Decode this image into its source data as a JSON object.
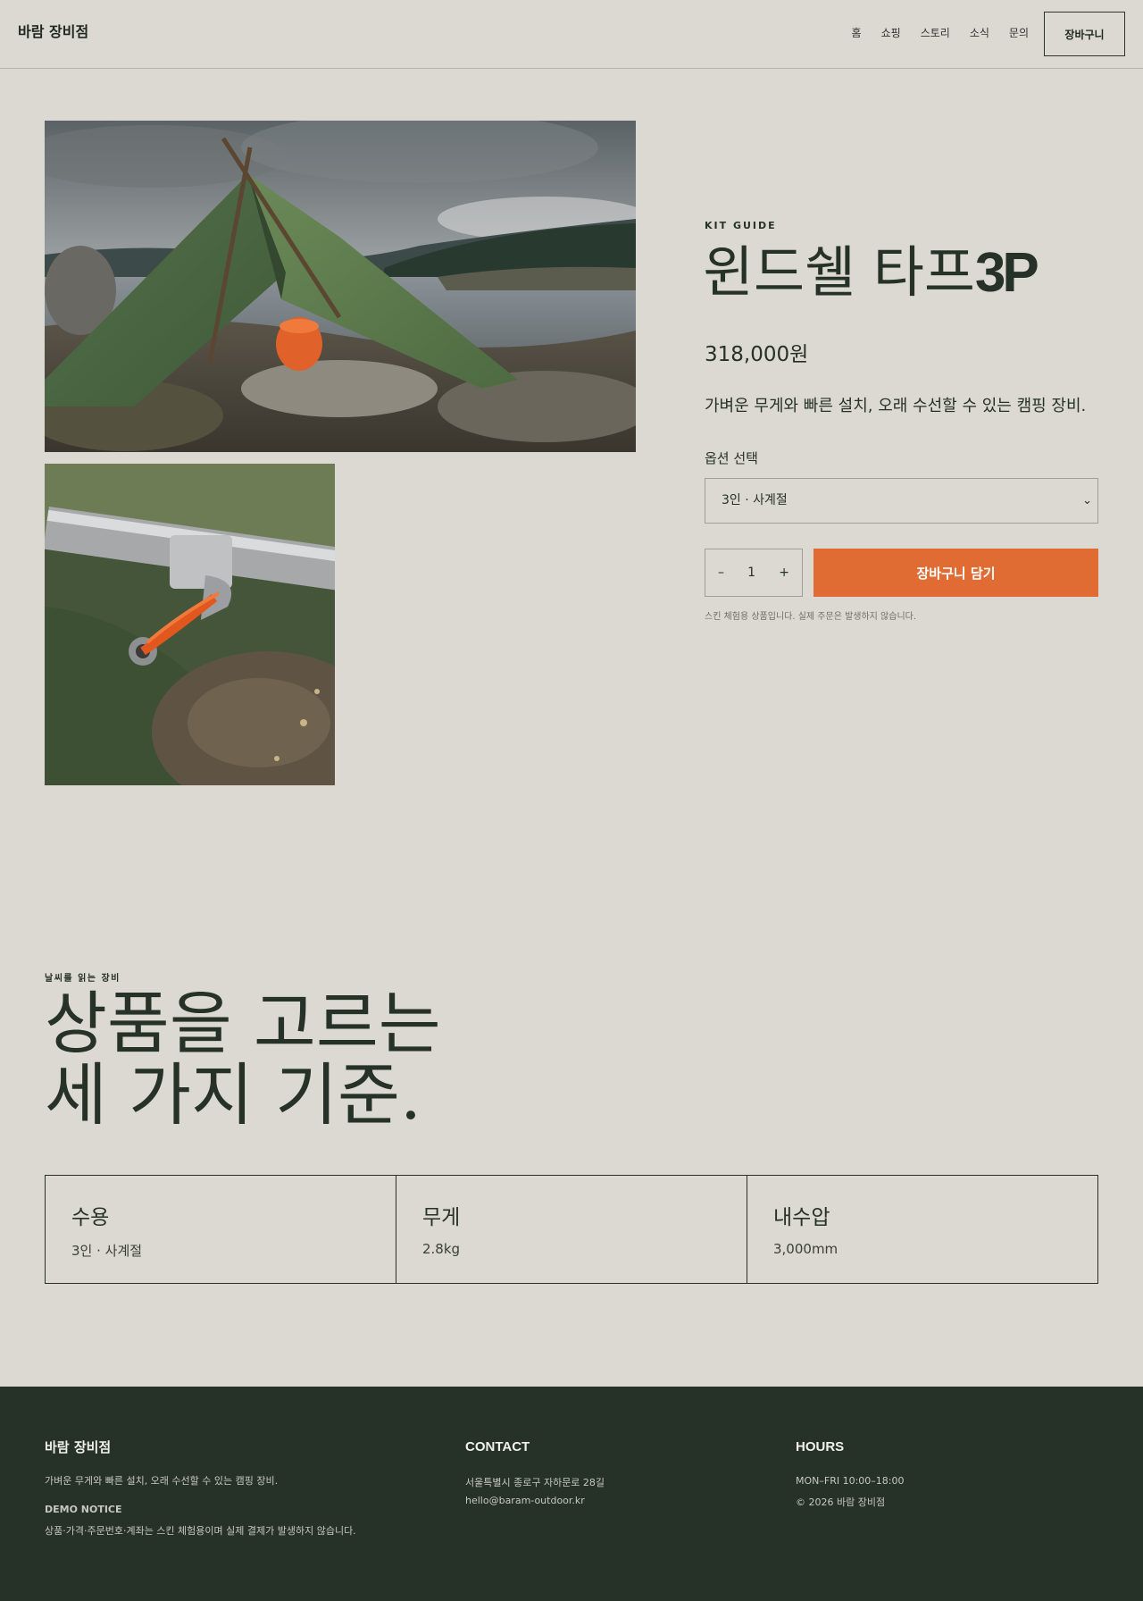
{
  "header": {
    "brand": "바람 장비점",
    "nav": [
      "홈",
      "쇼핑",
      "스토리",
      "소식",
      "문의"
    ],
    "cart_label": "장바구니"
  },
  "product": {
    "kicker": "KIT GUIDE",
    "title_ko": "윈드쉘 타프",
    "title_latin": "3P",
    "price": "318,000원",
    "description": "가벼운 무게와 빠른 설치, 오래 수선할 수 있는 캠핑 장비.",
    "option_label": "옵션 선택",
    "option_selected": "3인 · 사계절",
    "qty_minus": "–",
    "qty_value": "1",
    "qty_plus": "+",
    "add_label": "장바구니 담기",
    "demo_note": "스킨 체험용 상품입니다. 실제 주문은 발생하지 않습니다."
  },
  "criteria_section": {
    "kicker": "날씨를 읽는 장비",
    "title_line1": "상품을 고르는",
    "title_line2": "세 가지 기준.",
    "items": [
      {
        "name": "수용",
        "value": "3인 · 사계절"
      },
      {
        "name": "무게",
        "value": "2.8kg"
      },
      {
        "name": "내수압",
        "value": "3,000mm"
      }
    ]
  },
  "footer": {
    "brand": "바람 장비점",
    "tagline": "가벼운 무게와 빠른 설치, 오래 수선할 수 있는 캠핑 장비.",
    "notice_heading": "DEMO NOTICE",
    "notice_text": "상품·가격·주문번호·계좌는 스킨 체험용이며 실제 결제가 발생하지 않습니다.",
    "contact_heading": "CONTACT",
    "address": "서울특별시 종로구 자하문로 28길",
    "email": "hello@baram-outdoor.kr",
    "hours_heading": "HOURS",
    "hours": "MON–FRI 10:00–18:00",
    "copyright": "© 2026 바람 장비점"
  },
  "colors": {
    "background": "#dbd9d1",
    "text": "#263127",
    "accent": "#e06c33",
    "footer_bg": "#263128"
  },
  "icons": {
    "select_chevron": "chevron-down-icon"
  }
}
